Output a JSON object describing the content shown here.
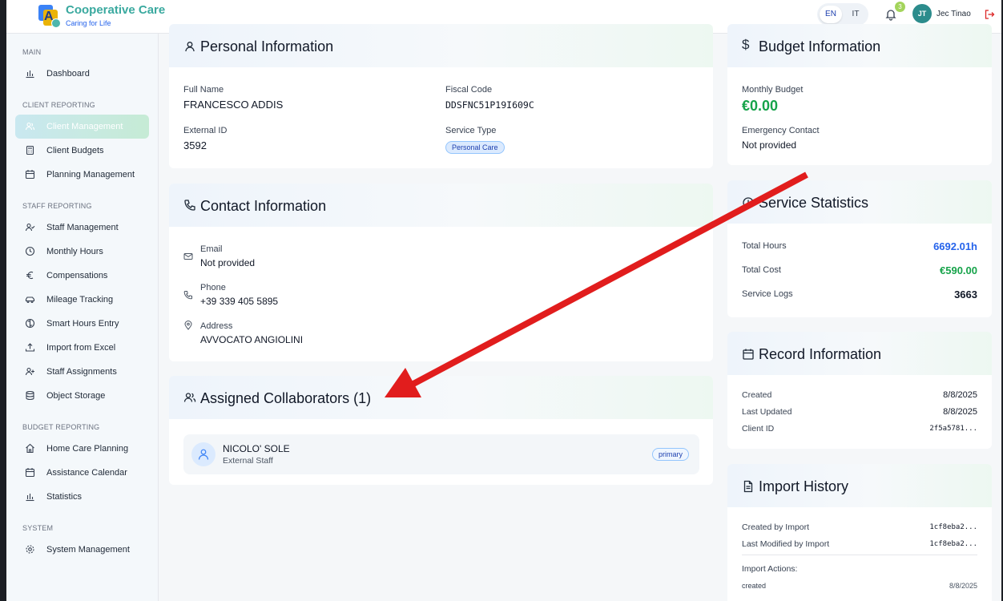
{
  "header": {
    "brand_title": "Cooperative Care",
    "brand_subtitle": "Caring for Life",
    "logo_letter": "A",
    "lang_en": "EN",
    "lang_it": "IT",
    "notifications_count": "3",
    "user_initials": "JT",
    "user_name": "Jec Tinao"
  },
  "sidebar": {
    "sections": [
      {
        "title": "MAIN",
        "items": [
          {
            "label": "Dashboard",
            "icon": "bar-chart-icon"
          }
        ]
      },
      {
        "title": "CLIENT REPORTING",
        "items": [
          {
            "label": "Client Management",
            "icon": "users-icon",
            "active": true
          },
          {
            "label": "Client Budgets",
            "icon": "calculator-icon"
          },
          {
            "label": "Planning Management",
            "icon": "calendar-icon"
          }
        ]
      },
      {
        "title": "STAFF REPORTING",
        "items": [
          {
            "label": "Staff Management",
            "icon": "user-check-icon"
          },
          {
            "label": "Monthly Hours",
            "icon": "clock-icon"
          },
          {
            "label": "Compensations",
            "icon": "euro-icon"
          },
          {
            "label": "Mileage Tracking",
            "icon": "car-icon"
          },
          {
            "label": "Smart Hours Entry",
            "icon": "brain-icon"
          },
          {
            "label": "Import from Excel",
            "icon": "upload-icon"
          },
          {
            "label": "Staff Assignments",
            "icon": "user-plus-icon"
          },
          {
            "label": "Object Storage",
            "icon": "database-icon"
          }
        ]
      },
      {
        "title": "BUDGET REPORTING",
        "items": [
          {
            "label": "Home Care Planning",
            "icon": "home-icon"
          },
          {
            "label": "Assistance Calendar",
            "icon": "calendar-icon"
          },
          {
            "label": "Statistics",
            "icon": "bar-chart-icon"
          }
        ]
      },
      {
        "title": "SYSTEM",
        "items": [
          {
            "label": "System Management",
            "icon": "gear-icon"
          }
        ]
      }
    ]
  },
  "personal": {
    "title": "Personal Information",
    "full_name_label": "Full Name",
    "full_name": "FRANCESCO ADDIS",
    "fiscal_code_label": "Fiscal Code",
    "fiscal_code": "DDSFNC51P19I609C",
    "external_id_label": "External ID",
    "external_id": "3592",
    "service_type_label": "Service Type",
    "service_type": "Personal Care"
  },
  "contact": {
    "title": "Contact Information",
    "email_label": "Email",
    "email": "Not provided",
    "phone_label": "Phone",
    "phone": "+39 339 405 5895",
    "address_label": "Address",
    "address": "AVVOCATO ANGIOLINI"
  },
  "collaborators": {
    "title": "Assigned Collaborators (1)",
    "items": [
      {
        "name": "NICOLO' SOLE",
        "role": "External Staff",
        "badge": "primary"
      }
    ]
  },
  "budget": {
    "title": "Budget Information",
    "monthly_label": "Monthly Budget",
    "monthly_value": "€0.00",
    "emergency_label": "Emergency Contact",
    "emergency_value": "Not provided"
  },
  "stats": {
    "title": "Service Statistics",
    "total_hours_label": "Total Hours",
    "total_hours": "6692.01h",
    "total_cost_label": "Total Cost",
    "total_cost": "€590.00",
    "service_logs_label": "Service Logs",
    "service_logs": "3663"
  },
  "record": {
    "title": "Record Information",
    "created_label": "Created",
    "created": "8/8/2025",
    "updated_label": "Last Updated",
    "updated": "8/8/2025",
    "client_id_label": "Client ID",
    "client_id": "2f5a5781..."
  },
  "import_history": {
    "title": "Import History",
    "created_by_label": "Created by Import",
    "created_by": "1cf8eba2...",
    "modified_by_label": "Last Modified by Import",
    "modified_by": "1cf8eba2...",
    "actions_label": "Import Actions:",
    "action_name": "created",
    "action_date": "8/8/2025"
  },
  "colors": {
    "brand": "#3aa99f",
    "accent_blue": "#2563eb",
    "money_green": "#16a34a",
    "arrow_red": "#e11d1d"
  }
}
